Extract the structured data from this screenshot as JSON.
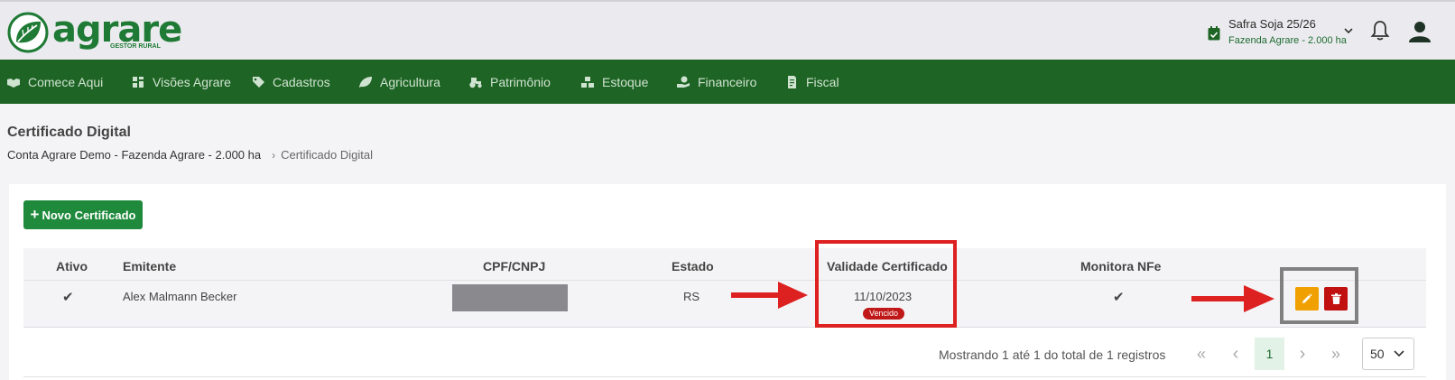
{
  "brand": {
    "name": "agrare",
    "tagline": "GESTOR RURAL",
    "color": "#1e7a34"
  },
  "header": {
    "season": "Safra Soja 25/26",
    "farm": "Fazenda Agrare - 2.000 ha"
  },
  "nav": [
    {
      "label": "Comece Aqui",
      "icon": "handshake-icon"
    },
    {
      "label": "Visões Agrare",
      "icon": "dashboard-icon"
    },
    {
      "label": "Cadastros",
      "icon": "tag-icon"
    },
    {
      "label": "Agricultura",
      "icon": "leaf-icon"
    },
    {
      "label": "Patrimônio",
      "icon": "tractor-icon"
    },
    {
      "label": "Estoque",
      "icon": "boxes-icon"
    },
    {
      "label": "Financeiro",
      "icon": "money-hand-icon"
    },
    {
      "label": "Fiscal",
      "icon": "invoice-icon"
    }
  ],
  "page": {
    "title": "Certificado Digital",
    "breadcrumb": [
      "Conta Agrare Demo - Fazenda Agrare - 2.000 ha",
      "Certificado Digital"
    ]
  },
  "actions": {
    "new_label": "Novo Certificado"
  },
  "table": {
    "columns": [
      "Ativo",
      "Emitente",
      "CPF/CNPJ",
      "Estado",
      "Validade Certificado",
      "Monitora NFe"
    ],
    "rows": [
      {
        "ativo": "✔",
        "emitente": "Alex Malmann Becker",
        "estado": "RS",
        "validade": "11/10/2023",
        "status": "Vencido",
        "monitora": "✔"
      }
    ]
  },
  "pagination": {
    "summary": "Mostrando 1 até 1 do total de 1 registros",
    "first": "«",
    "prev": "‹",
    "current": "1",
    "next": "›",
    "last": "»",
    "per_page": "50"
  },
  "colors": {
    "nav_bg": "#1e6424",
    "primary_button": "#1f8a3c",
    "edit": "#f0a000",
    "delete": "#c01010",
    "highlight_red": "#dd2020",
    "highlight_gray": "#808080"
  }
}
